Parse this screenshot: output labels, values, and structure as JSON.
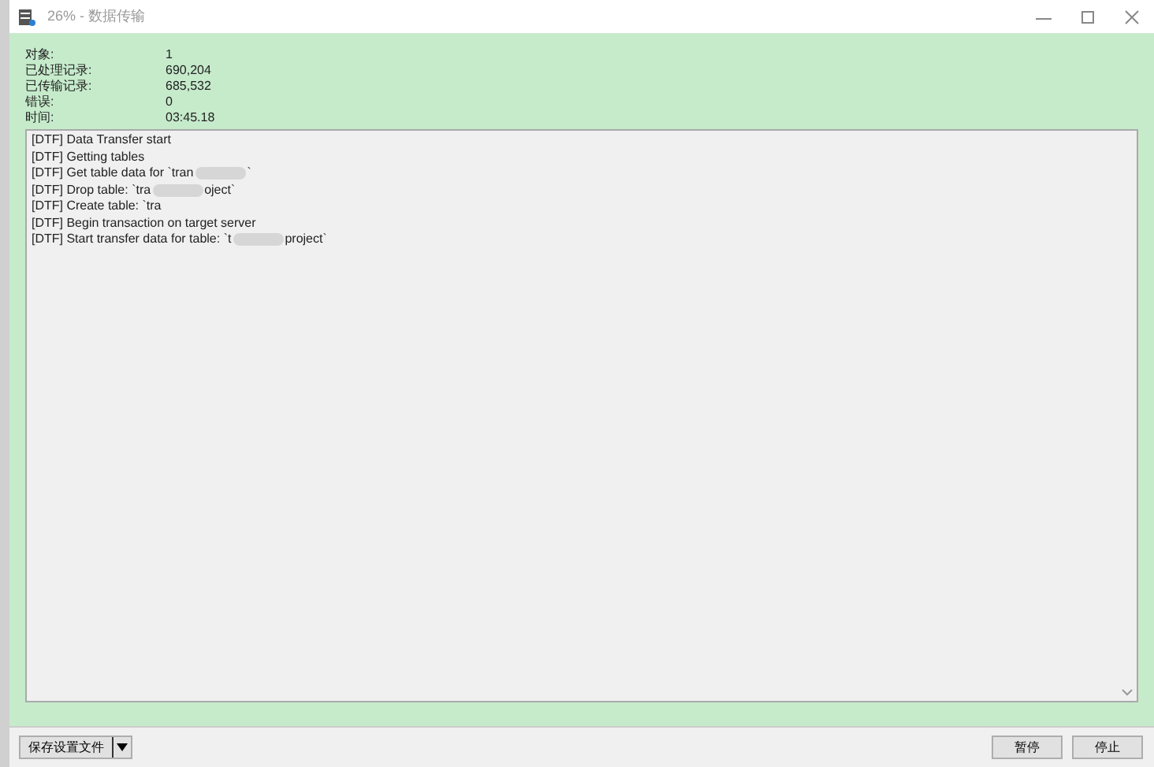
{
  "window": {
    "title": "26% - 数据传输"
  },
  "stats": [
    {
      "label": "对象:",
      "value": "1"
    },
    {
      "label": "已处理记录:",
      "value": "690,204"
    },
    {
      "label": "已传输记录:",
      "value": "685,532"
    },
    {
      "label": "错误:",
      "value": "0"
    },
    {
      "label": "时间:",
      "value": "03:45.18"
    }
  ],
  "log": [
    {
      "text": "[DTF] Data Transfer start"
    },
    {
      "text": "[DTF] Getting tables"
    },
    {
      "text": "[DTF] Get table data for `tran",
      "tail": "`"
    },
    {
      "text": "[DTF] Drop table: `tra",
      "tail": "oject`"
    },
    {
      "text": "[DTF] Create table: `tra"
    },
    {
      "text": "[DTF] Begin transaction on target server"
    },
    {
      "text": "[DTF] Start transfer data for table: `t",
      "tail": "project`"
    }
  ],
  "footer": {
    "save_button": "保存设置文件",
    "buttons": [
      "暂停",
      "停止"
    ]
  }
}
